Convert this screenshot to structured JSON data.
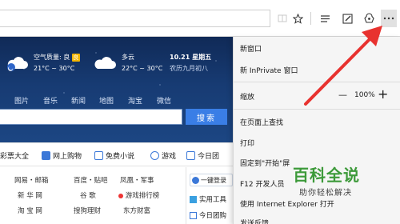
{
  "page": {
    "weather": [
      {
        "title": "空气质量: 良",
        "aqi_icon": "良",
        "temp": "21°C ~ 30°C"
      },
      {
        "title": "多云",
        "temp": "22°C ~ 30°C"
      }
    ],
    "date": {
      "date": "10.21 星期五",
      "lunar": "农历九月初八"
    },
    "nav_links": [
      "图片",
      "音乐",
      "新闻",
      "地图",
      "淘宝",
      "微信"
    ],
    "search_button": "搜索",
    "categories": [
      "彩票大全",
      "网上购物",
      "免费小说",
      "游戏",
      "今日团"
    ],
    "sites": [
      [
        "网易・邮箱",
        "百度・贴吧",
        "凤凰・军事"
      ],
      [
        "新 华 网",
        "谷 歌",
        "游戏排行榜"
      ],
      [
        "淘 宝 网",
        "搜狗理财",
        "东方财富"
      ]
    ],
    "side_items": [
      "一键登录",
      "实用工具",
      "今日团购"
    ]
  },
  "menu": {
    "new_window": "新窗口",
    "new_inprivate": "新 InPrivate 窗口",
    "zoom_label": "缩放",
    "zoom_minus": "—",
    "zoom_value": "100%",
    "zoom_plus": "+",
    "find": "在页面上查找",
    "print": "打印",
    "pin": "固定到\"开始\"屏",
    "f12": "F12 开发人员",
    "open_ie": "使用 Internet Explorer 打开",
    "feedback": "发送反馈"
  },
  "watermark": {
    "title": "百科全说",
    "subtitle": "助你轻松解决"
  },
  "colors": {
    "arrow": "#e8322f",
    "search_blue": "#3a7ee6",
    "hero": "#173b73"
  }
}
